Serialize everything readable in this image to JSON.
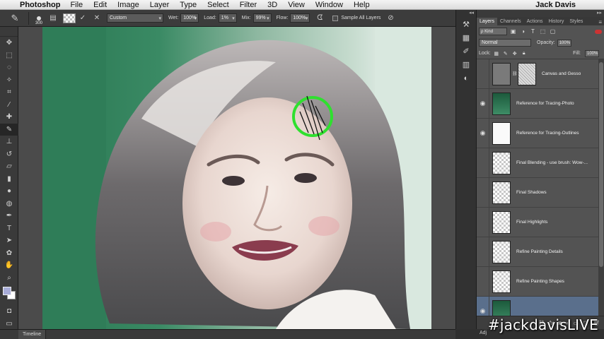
{
  "menubar": {
    "app_name": "Photoshop",
    "items": [
      "File",
      "Edit",
      "Image",
      "Layer",
      "Type",
      "Select",
      "Filter",
      "3D",
      "View",
      "Window",
      "Help"
    ],
    "user": "Jack Davis"
  },
  "options": {
    "brush_size": "300",
    "preset_value": "Custom",
    "wet_label": "Wet:",
    "wet_value": "100%",
    "load_label": "Load:",
    "load_value": "1%",
    "mix_label": "Mix:",
    "mix_value": "99%",
    "flow_label": "Flow:",
    "flow_value": "100%",
    "sample_all_label": "Sample All Layers"
  },
  "toolbox": {
    "active_tool": "mixer-brush",
    "foreground_color": "#a8acd8",
    "background_color": "#ffffff"
  },
  "timeline": {
    "tab_label": "Timeline"
  },
  "panel": {
    "tabs": [
      "Layers",
      "Channels",
      "Actions",
      "History",
      "Styles"
    ],
    "active_tab": "Layers",
    "kind_label": "ρ Kind",
    "blend_mode": "Normal",
    "opacity_label": "Opacity:",
    "opacity_value": "100%",
    "lock_label": "Lock:",
    "fill_label": "Fill:",
    "fill_value": "100%",
    "layers": [
      {
        "name": "Canvas and Gesso",
        "visible": false
      },
      {
        "name": "Reference for Tracing-Photo",
        "visible": true
      },
      {
        "name": "Reference for Tracing-Outlines",
        "visible": true
      },
      {
        "name": "Final Blending - use brush: Wow-...",
        "visible": false
      },
      {
        "name": "Final Shadows",
        "visible": false
      },
      {
        "name": "Final Highlights",
        "visible": false
      },
      {
        "name": "Refine Painting Details",
        "visible": false
      },
      {
        "name": "Refine Painting Shapes",
        "visible": false
      },
      {
        "name": "",
        "visible": true,
        "selected": true
      }
    ]
  },
  "adjustments_tab": "Adj",
  "watermark": "#jackdavisLIVE",
  "accent_colors": {
    "cursor_ring": "#2fe02f",
    "selected_layer": "#5a6f8c"
  }
}
